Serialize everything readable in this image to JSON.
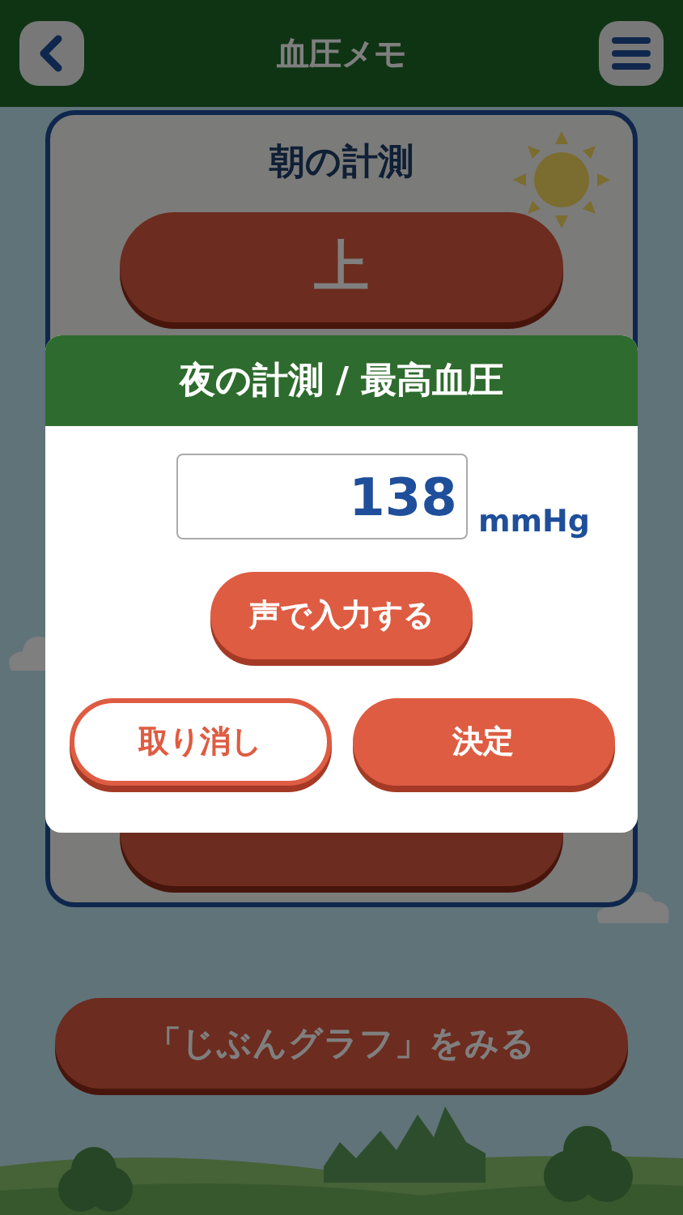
{
  "header": {
    "title": "血圧メモ"
  },
  "card": {
    "title": "朝の計測",
    "upper_button": "上"
  },
  "graph_button": "「じぶんグラフ」をみる",
  "dialog": {
    "title": "夜の計測 / 最高血圧",
    "input": {
      "value": "138",
      "unit": "mmHg"
    },
    "voice_button": "声で入力する",
    "cancel_button": "取り消し",
    "ok_button": "決定"
  }
}
